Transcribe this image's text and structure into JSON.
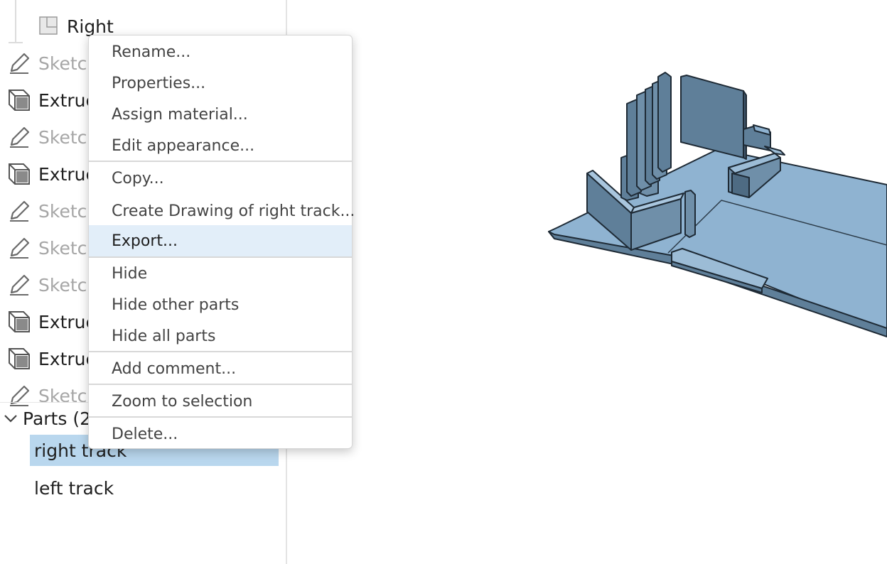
{
  "tree": {
    "plane_label": "Right",
    "features": [
      {
        "type": "sketch",
        "label": "Sketc"
      },
      {
        "type": "extrude",
        "label": "Extruc"
      },
      {
        "type": "sketch",
        "label": "Sketc"
      },
      {
        "type": "extrude",
        "label": "Extruc"
      },
      {
        "type": "sketch",
        "label": "Sketc"
      },
      {
        "type": "sketch",
        "label": "Sketc"
      },
      {
        "type": "sketch",
        "label": "Sketc"
      },
      {
        "type": "extrude",
        "label": "Extruc"
      },
      {
        "type": "extrude",
        "label": "Extruc"
      },
      {
        "type": "sketch",
        "label": "Sketc"
      }
    ],
    "parts_header": "Parts (2",
    "parts": [
      {
        "label": "right track",
        "selected": true
      },
      {
        "label": "left track",
        "selected": false
      }
    ]
  },
  "context_menu": {
    "items": [
      "Rename...",
      "Properties...",
      "Assign material...",
      "Edit appearance...",
      "Copy...",
      "Create Drawing of right track...",
      "Export...",
      "Hide",
      "Hide other parts",
      "Hide all parts",
      "Add comment...",
      "Zoom to selection",
      "Delete..."
    ],
    "highlighted": "Export..."
  },
  "colors": {
    "part_fill": "#8fb3d1",
    "part_side": "#5f7f99",
    "selection": "#b9d7ee",
    "menu_highlight": "#e2eef9"
  }
}
